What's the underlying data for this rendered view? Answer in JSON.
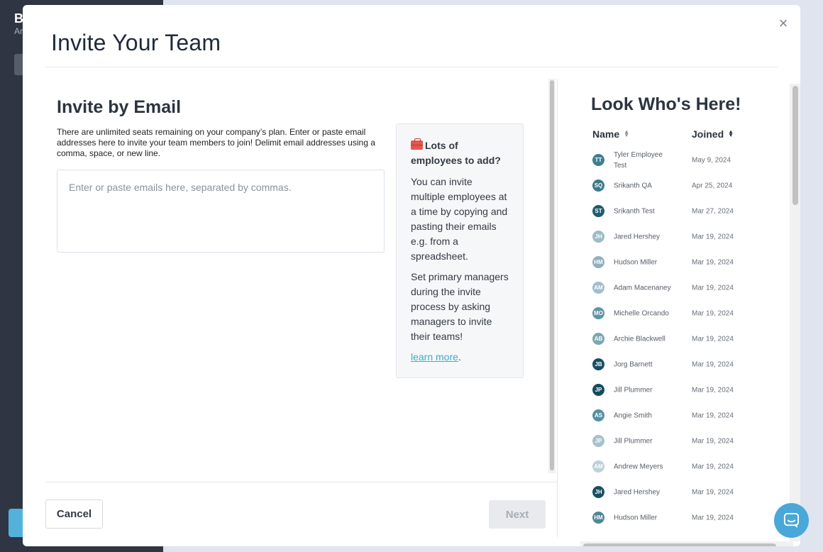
{
  "background": {
    "title": "B",
    "subtitle": "Ar"
  },
  "modal": {
    "title": "Invite Your Team",
    "close_label": "×"
  },
  "invite": {
    "title": "Invite by Email",
    "description": "There are unlimited seats remaining on your company’s plan. Enter or paste email addresses here to invite your team members to join! Delimit email addresses using a comma, space, or new line.",
    "placeholder": "Enter or paste emails here, separated by commas."
  },
  "tip": {
    "heading": "Lots of employees to add?",
    "paragraph1": "You can invite multiple employees at a time by copying and pasting their emails e.g. from a spreadsheet.",
    "paragraph2": "Set primary managers during the invite process by asking managers to invite their teams!",
    "link": "learn more",
    "link_suffix": "."
  },
  "footer": {
    "cancel_label": "Cancel",
    "next_label": "Next"
  },
  "members": {
    "title": "Look Who's Here!",
    "col_name": "Name",
    "col_joined": "Joined",
    "rows": [
      {
        "initials": "TT",
        "name": "Tyler Employee Test",
        "date": "May 9, 2024",
        "color": "#3e7f8f"
      },
      {
        "initials": "SQ",
        "name": "Srikanth QA",
        "date": "Apr 25, 2024",
        "color": "#3b7a8a"
      },
      {
        "initials": "ST",
        "name": "Srikanth Test",
        "date": "Mar 27, 2024",
        "color": "#1e5c6e"
      },
      {
        "initials": "JH",
        "name": "Jared Hershey",
        "date": "Mar 19, 2024",
        "color": "#9dbcc6"
      },
      {
        "initials": "HM",
        "name": "Hudson Miller",
        "date": "Mar 19, 2024",
        "color": "#8fb0bc"
      },
      {
        "initials": "AM",
        "name": "Adam Macenaney",
        "date": "Mar 19, 2024",
        "color": "#a1bec9"
      },
      {
        "initials": "MO",
        "name": "Michelle Orcando",
        "date": "Mar 19, 2024",
        "color": "#5f95a4"
      },
      {
        "initials": "AB",
        "name": "Archie Blackwell",
        "date": "Mar 19, 2024",
        "color": "#7ea6b3"
      },
      {
        "initials": "JB",
        "name": "Jorg Barnett",
        "date": "Mar 19, 2024",
        "color": "#174f62"
      },
      {
        "initials": "JP",
        "name": "Jill Plummer",
        "date": "Mar 19, 2024",
        "color": "#144c5f"
      },
      {
        "initials": "AS",
        "name": "Angie Smith",
        "date": "Mar 19, 2024",
        "color": "#5690a0"
      },
      {
        "initials": "JP",
        "name": "Jill Plummer",
        "date": "Mar 19, 2024",
        "color": "#a6c2cc"
      },
      {
        "initials": "AM",
        "name": "Andrew Meyers",
        "date": "Mar 19, 2024",
        "color": "#bcd2da"
      },
      {
        "initials": "JH",
        "name": "Jared Hershey",
        "date": "Mar 19, 2024",
        "color": "#174f62"
      },
      {
        "initials": "HM",
        "name": "Hudson Miller",
        "date": "Mar 19, 2024",
        "color": "#4d8797"
      }
    ]
  },
  "colors": {
    "accent": "#3ea9cf",
    "chat": "#4aa8d8"
  }
}
